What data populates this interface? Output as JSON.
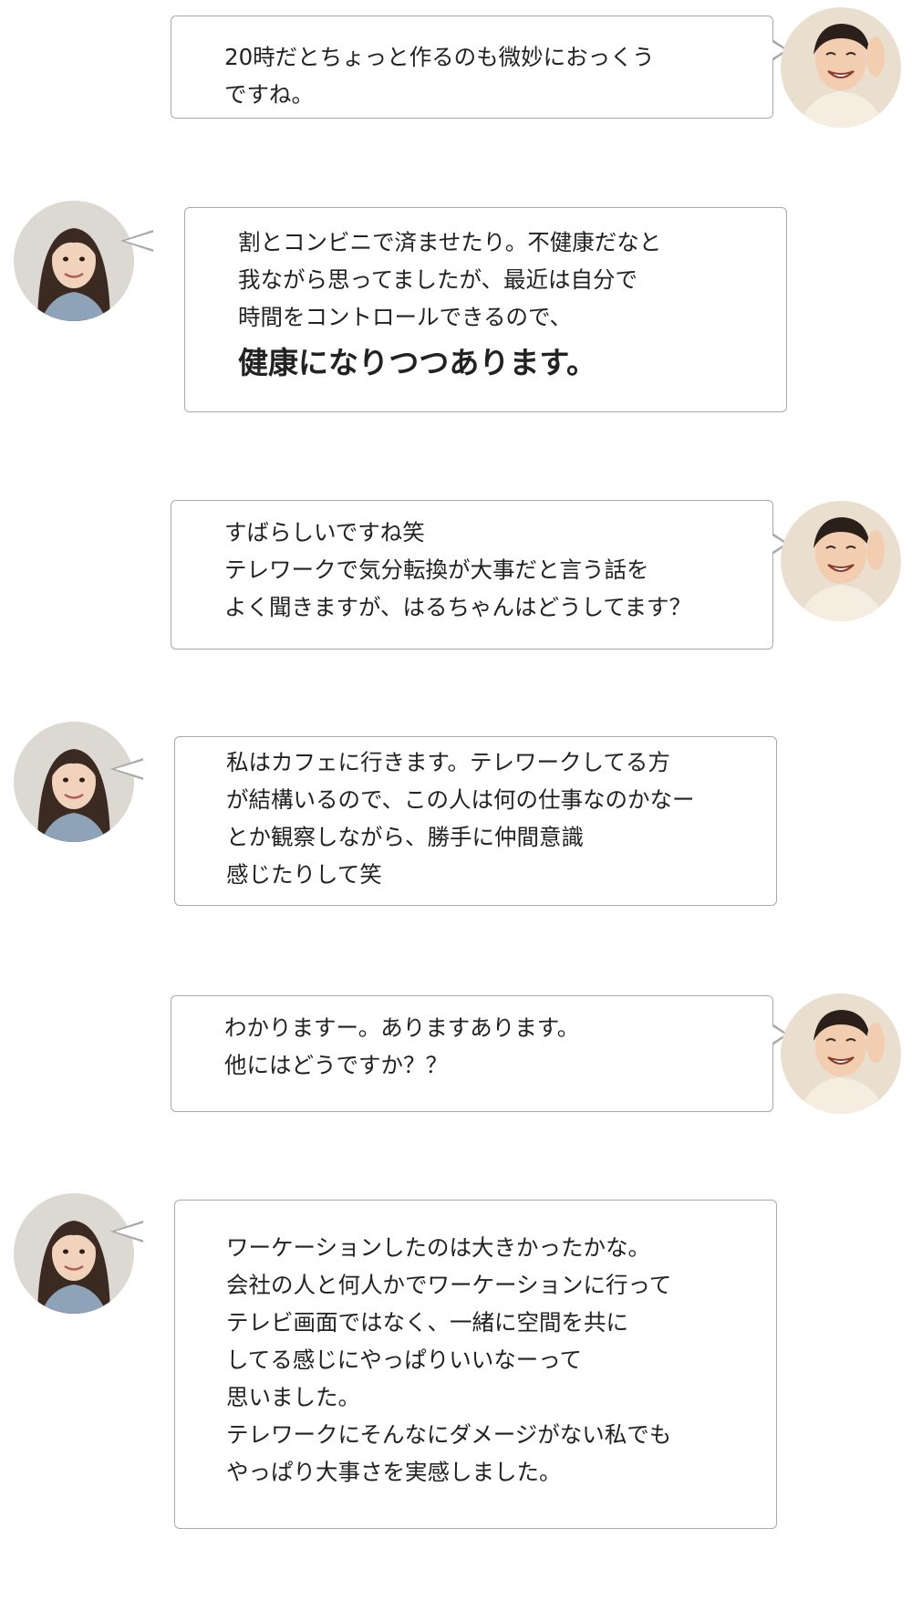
{
  "messages": [
    {
      "speaker": "interviewer",
      "lines": [
        "20時だとちょっと作るのも微妙におっくう",
        "ですね。"
      ]
    },
    {
      "speaker": "haru",
      "lines": [
        "割とコンビニで済ませたり。不健康だなと",
        "我ながら思ってましたが、最近は自分で",
        "時間をコントロールできるので、"
      ],
      "emphasis": "健康になりつつあります。"
    },
    {
      "speaker": "interviewer",
      "lines": [
        "すばらしいですね笑",
        "テレワークで気分転換が大事だと言う話を",
        "よく聞きますが、はるちゃんはどうしてます？"
      ]
    },
    {
      "speaker": "haru",
      "lines": [
        "私はカフェに行きます。テレワークしてる方",
        "が結構いるので、この人は何の仕事なのかなー",
        "とか観察しながら、勝手に仲間意識",
        "感じたりして笑"
      ]
    },
    {
      "speaker": "interviewer",
      "lines": [
        "わかりますー。ありますあります。",
        "他にはどうですか？？"
      ]
    },
    {
      "speaker": "haru",
      "lines": [
        "ワーケーションしたのは大きかったかな。",
        "会社の人と何人かでワーケーションに行って",
        "テレビ画面ではなく、一緒に空間を共に",
        "してる感じにやっぱりいいなーって",
        "思いました。",
        "テレワークにそんなにダメージがない私でも",
        "やっぱり大事さを実感しました。"
      ]
    }
  ],
  "colors": {
    "bubble_border": "#a9a9a9",
    "text": "#222222",
    "interviewer_bg": "#e8dccb",
    "haru_bg": "#d9d6d0"
  }
}
